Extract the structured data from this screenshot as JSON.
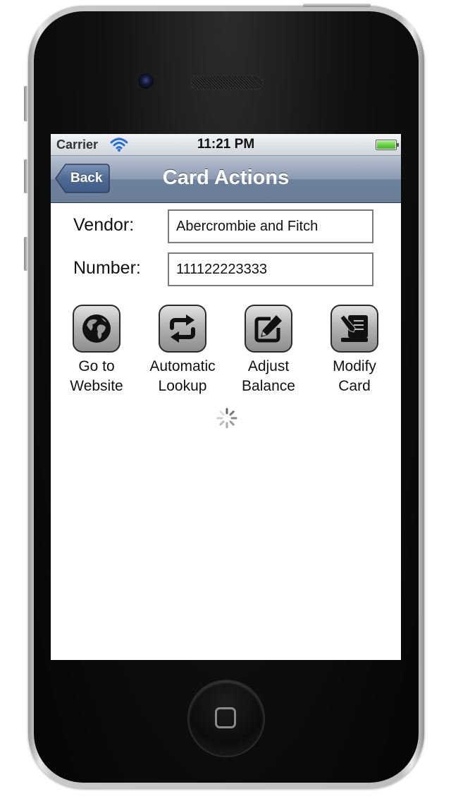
{
  "status_bar": {
    "carrier": "Carrier",
    "time": "11:21 PM"
  },
  "nav": {
    "back_label": "Back",
    "title": "Card Actions"
  },
  "form": {
    "vendor_label": "Vendor:",
    "vendor_value": "Abercrombie and Fitch",
    "number_label": "Number:",
    "number_value": "111122223333"
  },
  "actions": [
    {
      "label_line1": "Go to",
      "label_line2": "Website",
      "icon": "globe-icon"
    },
    {
      "label_line1": "Automatic",
      "label_line2": "Lookup",
      "icon": "refresh-icon"
    },
    {
      "label_line1": "Adjust",
      "label_line2": "Balance",
      "icon": "edit-pencil-icon"
    },
    {
      "label_line1": "Modify",
      "label_line2": "Card",
      "icon": "document-edit-icon"
    }
  ],
  "colors": {
    "nav_bar": "#6d819c",
    "back_button": "#4f6a93",
    "battery": "#3cb51e",
    "wifi": "#2a6fd6"
  }
}
